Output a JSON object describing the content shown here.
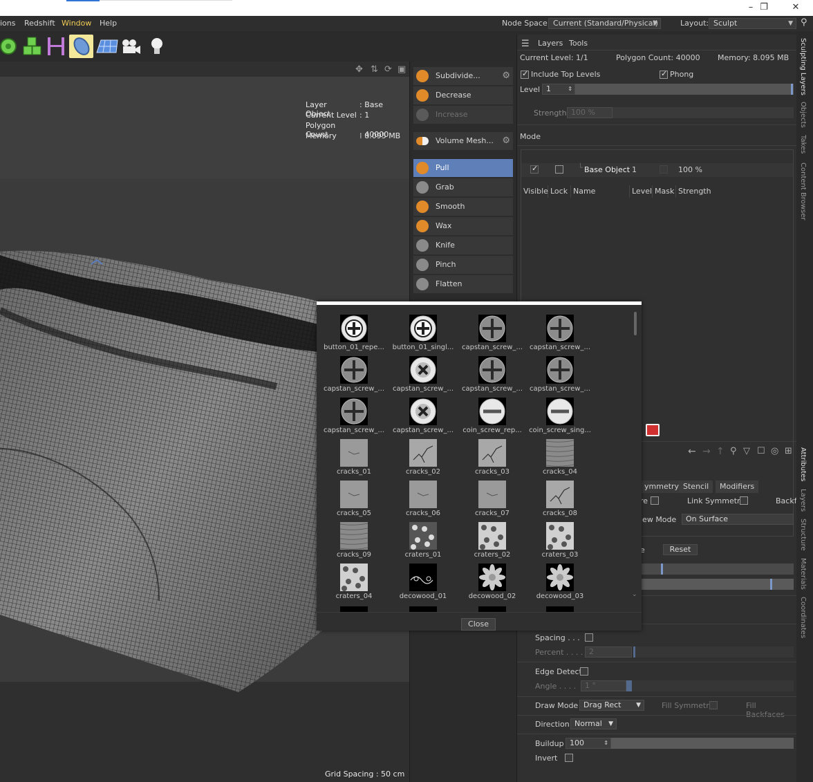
{
  "menubar": {
    "items": [
      "ions",
      "Redshift",
      "Window",
      "Help"
    ],
    "node_space_label": "Node Space:",
    "node_space_value": "Current (Standard/Physical)",
    "layout_label": "Layout:",
    "layout_value": "Sculpt"
  },
  "toolbar": {
    "icons": [
      "sphere-deformer-icon",
      "cube-cloner-icon",
      "spline-icon",
      "deformer-icon",
      "sculpt-brush-icon",
      "floor-icon",
      "camera-icon",
      "light-icon"
    ]
  },
  "viewport": {
    "hud": {
      "layer_key": "Layer",
      "layer_val": ": Base Object",
      "level_key": "Current Level",
      "level_val": ": 1",
      "poly_key": "Polygon Count",
      "poly_val": ": 40000",
      "mem_key": "Memory",
      "mem_val": ": 8.095 MB"
    },
    "grid_spacing": "Grid Spacing : 50 cm"
  },
  "commands": {
    "subdivide": "Subdivide...",
    "decrease": "Decrease",
    "increase": "Increase",
    "volume_mesh": "Volume Mesh...",
    "tools": [
      "Pull",
      "Grab",
      "Smooth",
      "Wax",
      "Knife",
      "Pinch",
      "Flatten"
    ]
  },
  "layers_panel": {
    "tab_layers": "Layers",
    "tab_tools": "Tools",
    "current_level": "Current Level: 1/1",
    "polygon_count": "Polygon Count: 40000",
    "memory": "Memory: 8.095 MB",
    "include_top_levels": "Include Top Levels",
    "phong": "Phong",
    "level_label": "Level",
    "level_value": "1",
    "strength_label": "Strength",
    "strength_value": "100 %",
    "mode_label": "Mode",
    "columns": [
      "Visible",
      "Lock",
      "Name",
      "Level",
      "Mask",
      "Strength"
    ],
    "row": {
      "name": "Base Object",
      "level": "1",
      "strength": "100 %"
    }
  },
  "attributes": {
    "tabs": [
      "ymmetry",
      "Stencil",
      "Modifiers"
    ],
    "re_label": "re",
    "link_symmetry": "Link Symmetry",
    "backf": "Backf",
    "view_mode_label": "iew Mode",
    "view_mode_value": "On Surface",
    "e_label": "e",
    "reset": "Reset",
    "spacing": "Spacing . . .",
    "percent_label": "Percent . . . .",
    "percent_value": "2",
    "edge_detect": "Edge Detect",
    "angle_label": "Angle . . . .",
    "angle_value": "1 °",
    "draw_mode_label": "Draw Mode",
    "draw_mode_value": "Drag Rect",
    "fill_symmetry": "Fill Symmetry",
    "fill_backfaces": "Fill Backfaces",
    "direction_label": "Direction",
    "direction_value": "Normal",
    "buildup_label": "Buildup",
    "buildup_value": "100",
    "invert_label": "Invert"
  },
  "side_tabs_top": [
    "Sculpting Layers",
    "Objects",
    "Takes",
    "Content Browser"
  ],
  "side_tabs_bottom": [
    "Attributes",
    "Layers",
    "Structure",
    "Materials",
    "Coordinates"
  ],
  "brush_popup": {
    "close": "Close",
    "brushes": [
      {
        "label": "button_01_repe...",
        "kind": "screw-plus"
      },
      {
        "label": "button_01_singl...",
        "kind": "screw-plus"
      },
      {
        "label": "capstan_screw_...",
        "kind": "screw-plus-gray"
      },
      {
        "label": "capstan_screw_...",
        "kind": "screw-plus-gray"
      },
      {
        "label": "capstan_screw_...",
        "kind": "screw-plus-gray"
      },
      {
        "label": "capstan_screw_...",
        "kind": "screw-x"
      },
      {
        "label": "capstan_screw_...",
        "kind": "screw-plus-gray"
      },
      {
        "label": "capstan_screw_...",
        "kind": "screw-plus-gray"
      },
      {
        "label": "capstan_screw_...",
        "kind": "screw-plus-gray"
      },
      {
        "label": "capstan_screw_...",
        "kind": "screw-x"
      },
      {
        "label": "coin_screw_rep...",
        "kind": "screw-minus"
      },
      {
        "label": "coin_screw_sing...",
        "kind": "screw-minus"
      },
      {
        "label": "cracks_01",
        "kind": "texture-light"
      },
      {
        "label": "cracks_02",
        "kind": "texture-crack"
      },
      {
        "label": "cracks_03",
        "kind": "texture-crack"
      },
      {
        "label": "cracks_04",
        "kind": "texture-dense"
      },
      {
        "label": "cracks_05",
        "kind": "texture-light"
      },
      {
        "label": "cracks_06",
        "kind": "texture-light"
      },
      {
        "label": "cracks_07",
        "kind": "texture-light"
      },
      {
        "label": "cracks_08",
        "kind": "texture-crack"
      },
      {
        "label": "cracks_09",
        "kind": "texture-dense"
      },
      {
        "label": "craters_01",
        "kind": "texture-craters-dark"
      },
      {
        "label": "craters_02",
        "kind": "texture-craters"
      },
      {
        "label": "craters_03",
        "kind": "texture-craters"
      },
      {
        "label": "craters_04",
        "kind": "texture-craters"
      },
      {
        "label": "decowood_01",
        "kind": "texture-deco"
      },
      {
        "label": "decowood_02",
        "kind": "texture-flower"
      },
      {
        "label": "decowood_03",
        "kind": "texture-flower"
      }
    ]
  },
  "colors": {
    "accent_selected": "#5e7fb8",
    "toolbar_selected": "#f4e89a",
    "menu_active": "#f0cc55"
  }
}
